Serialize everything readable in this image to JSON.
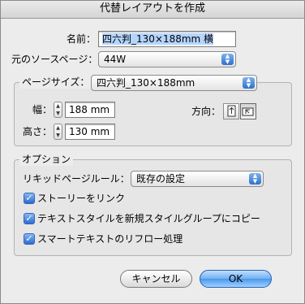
{
  "dialog": {
    "title": "代替レイアウトを作成"
  },
  "name_field": {
    "label": "名前：",
    "value": "四六判_130×188mm 横"
  },
  "source_page": {
    "label": "元のソースページ：",
    "value": "44W"
  },
  "page_size": {
    "label": "ページサイズ：",
    "value": "四六判_130×188mm",
    "width_label": "幅：",
    "width_value": "188 mm",
    "height_label": "高さ：",
    "height_value": "130 mm",
    "orientation_label": "方向："
  },
  "options": {
    "title": "オプション",
    "liquid_rule_label": "リキッドページルール：",
    "liquid_rule_value": "既存の設定",
    "checkboxes": [
      {
        "label": "ストーリーをリンク",
        "checked": true
      },
      {
        "label": "テキストスタイルを新規スタイルグループにコピー",
        "checked": true
      },
      {
        "label": "スマートテキストのリフロー処理",
        "checked": true
      }
    ]
  },
  "buttons": {
    "cancel": "キャンセル",
    "ok": "OK"
  },
  "glyphs": {
    "check": "✓",
    "up": "▲",
    "down": "▼"
  }
}
